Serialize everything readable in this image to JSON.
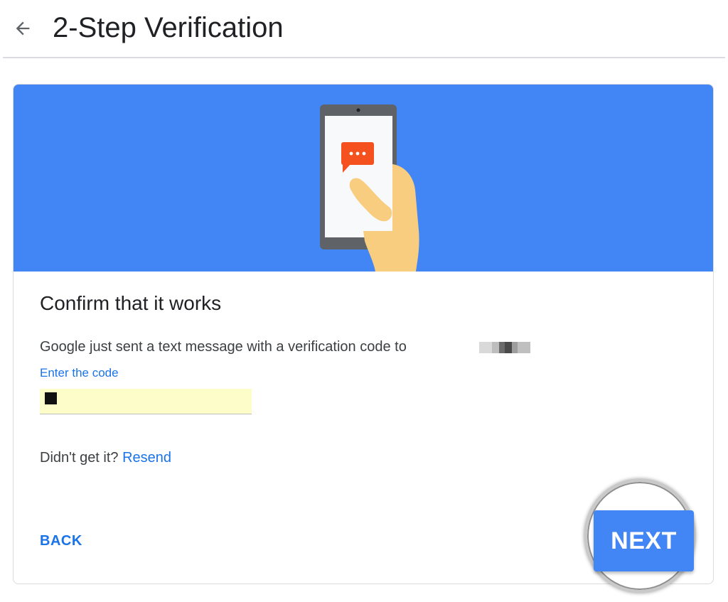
{
  "header": {
    "back_icon": "arrow-left-icon",
    "title": "2-Step Verification"
  },
  "banner": {
    "illustration": "phone-sms-illustration",
    "colors": {
      "background": "#4285f4",
      "phone_frame": "#5f6368",
      "screen": "#f8f9fa",
      "message_bubble": "#f4511e",
      "hand": "#f8cd7f"
    }
  },
  "content": {
    "title": "Confirm that it works",
    "description": "Google just sent a text message with a verification code to",
    "code_field": {
      "label": "Enter the code",
      "value": ""
    },
    "resend": {
      "prompt": "Didn't get it?",
      "link_label": "Resend"
    }
  },
  "actions": {
    "back_label": "BACK",
    "next_label": "NEXT"
  },
  "colors": {
    "accent": "#1a73e8",
    "primary_button": "#4285f4",
    "input_autofill": "#fcfdc9"
  }
}
